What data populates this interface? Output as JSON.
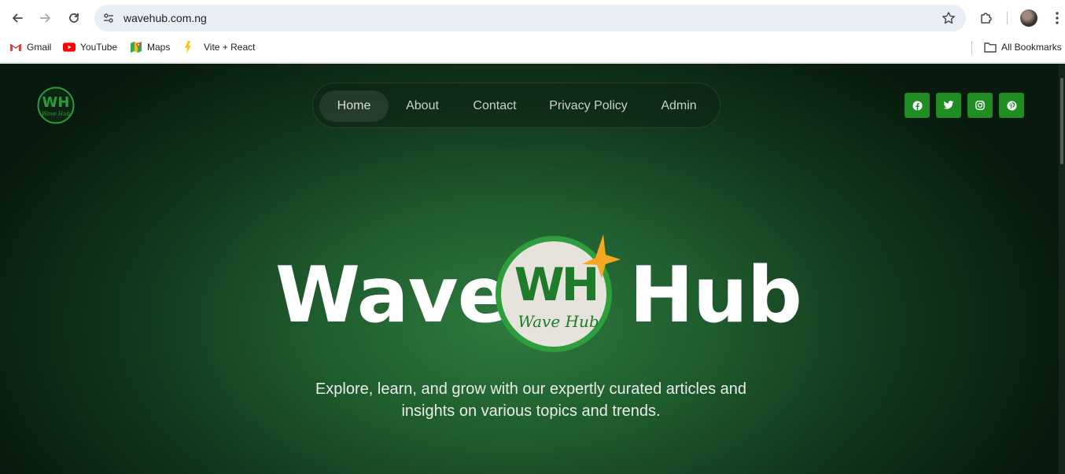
{
  "browser": {
    "url": "wavehub.com.ng",
    "icons": {
      "back": "arrow-left-icon",
      "forward": "arrow-right-icon",
      "reload": "reload-icon",
      "site_settings": "tune-icon",
      "bookmark": "star-icon",
      "extensions": "puzzle-icon",
      "profile": "avatar",
      "menu": "kebab-menu-icon"
    },
    "bookmarks": [
      {
        "label": "Gmail",
        "icon": "gmail-icon"
      },
      {
        "label": "YouTube",
        "icon": "youtube-icon"
      },
      {
        "label": "Maps",
        "icon": "maps-icon"
      },
      {
        "label": "Vite + React",
        "icon": "vite-icon"
      }
    ],
    "all_bookmarks": "All Bookmarks"
  },
  "site": {
    "logo_text": "WH",
    "logo_script": "Wave Hub",
    "nav": [
      {
        "label": "Home",
        "active": true
      },
      {
        "label": "About",
        "active": false
      },
      {
        "label": "Contact",
        "active": false
      },
      {
        "label": "Privacy Policy",
        "active": false
      },
      {
        "label": "Admin",
        "active": false
      }
    ],
    "social": [
      "facebook-icon",
      "twitter-icon",
      "instagram-icon",
      "pinterest-icon"
    ],
    "hero": {
      "word_left": "Wave",
      "word_right": "Hub",
      "tagline": "Explore, learn, and grow with our expertly curated articles and insights on various topics and trends."
    },
    "colors": {
      "accent_green": "#1f8c24",
      "logo_green": "#1e7b2a",
      "star_orange": "#f5a623"
    }
  }
}
